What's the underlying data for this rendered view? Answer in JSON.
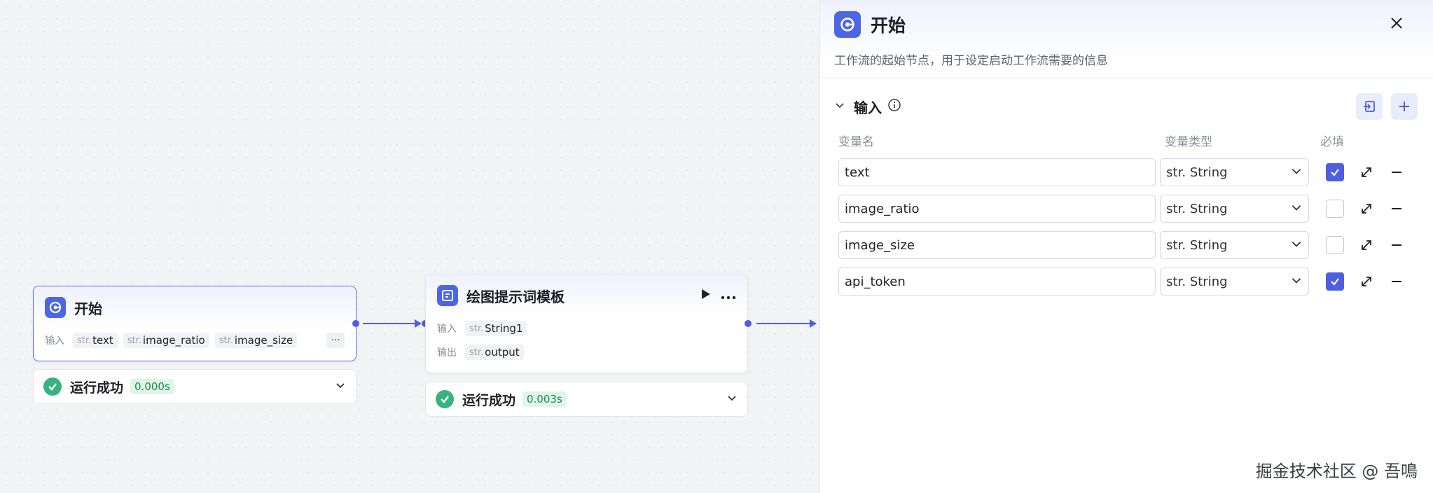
{
  "nodes": {
    "start": {
      "title": "开始",
      "input_label": "输入",
      "tags": [
        {
          "prefix": "str.",
          "name": "text"
        },
        {
          "prefix": "str.",
          "name": "image_ratio"
        },
        {
          "prefix": "str.",
          "name": "image_size"
        }
      ],
      "more": "···",
      "status": {
        "text": "运行成功",
        "time": "0.000s"
      }
    },
    "prompt_template": {
      "title": "绘图提示词模板",
      "input_label": "输入",
      "output_label": "输出",
      "input_tag": {
        "prefix": "str.",
        "name": "String1"
      },
      "output_tag": {
        "prefix": "str.",
        "name": "output"
      },
      "status": {
        "text": "运行成功",
        "time": "0.003s"
      }
    }
  },
  "panel": {
    "title": "开始",
    "description": "工作流的起始节点，用于设定启动工作流需要的信息",
    "section_title": "输入",
    "columns": {
      "name": "变量名",
      "type": "变量类型",
      "required": "必填"
    },
    "variables": [
      {
        "name": "text",
        "type_prefix": "str.",
        "type": "String",
        "required": true
      },
      {
        "name": "image_ratio",
        "type_prefix": "str.",
        "type": "String",
        "required": false
      },
      {
        "name": "image_size",
        "type_prefix": "str.",
        "type": "String",
        "required": false
      },
      {
        "name": "api_token",
        "type_prefix": "str.",
        "type": "String",
        "required": true
      }
    ]
  },
  "watermark": "掘金技术社区 @ 吾鳴",
  "colors": {
    "accent": "#4d5ee0",
    "success": "#36b37e",
    "node_icon": "#4d66e6"
  }
}
